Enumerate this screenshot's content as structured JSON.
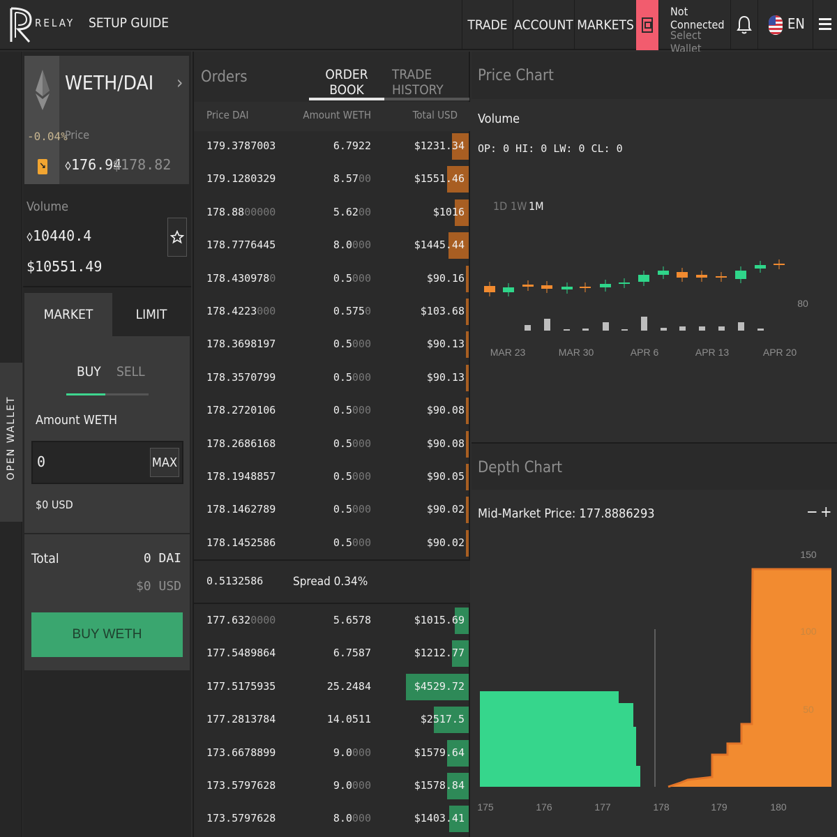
{
  "header": {
    "brand": "RELAY",
    "setup_guide": "SETUP GUIDE",
    "nav": [
      "TRADE",
      "ACCOUNT",
      "MARKETS"
    ],
    "wallet_status": "Not Connected",
    "wallet_action": "Select Wallet",
    "language": "EN"
  },
  "sidebar": {
    "open_wallet": "OPEN WALLET"
  },
  "pair": {
    "name": "WETH/DAI",
    "change_pct": "-0.04%",
    "price_label": "Price",
    "price": "⬨176.94",
    "price_usd": "$178.82",
    "volume_label": "Volume",
    "volume_eth": "⬨10440.4",
    "volume_usd": "$10551.49"
  },
  "trade_form": {
    "tab_market": "MARKET",
    "tab_limit": "LIMIT",
    "side_buy": "BUY",
    "side_sell": "SELL",
    "amount_label": "Amount WETH",
    "amount_value": "0",
    "max_label": "MAX",
    "usd_hint": "$0 USD",
    "total_label": "Total",
    "total_dai": "0 DAI",
    "total_usd": "$0 USD",
    "buy_button": "BUY WETH"
  },
  "orders": {
    "title": "Orders",
    "tab_order_book": "ORDER BOOK",
    "tab_trade_history": "TRADE HISTORY",
    "col_price": "Price DAI",
    "col_amount": "Amount WETH",
    "col_total": "Total USD",
    "asks": [
      {
        "price": "179.3787003",
        "price_dim": "",
        "amount": "6.7922",
        "amount_dim": "",
        "total": "$1231.34",
        "depth": 0.27
      },
      {
        "price": "179.1280329",
        "price_dim": "",
        "amount": "8.57",
        "amount_dim": "00",
        "total": "$1551.46",
        "depth": 0.34
      },
      {
        "price": "178.88",
        "price_dim": "00000",
        "amount": "5.62",
        "amount_dim": "00",
        "total": "$1016",
        "depth": 0.22
      },
      {
        "price": "178.7776445",
        "price_dim": "",
        "amount": "8.0",
        "amount_dim": "000",
        "total": "$1445.44",
        "depth": 0.32
      },
      {
        "price": "178.430978",
        "price_dim": "0",
        "amount": "0.5",
        "amount_dim": "000",
        "total": "$90.16",
        "depth": 0.02
      },
      {
        "price": "178.4223",
        "price_dim": "000",
        "amount": "0.575",
        "amount_dim": "0",
        "total": "$103.68",
        "depth": 0.02
      },
      {
        "price": "178.3698197",
        "price_dim": "",
        "amount": "0.5",
        "amount_dim": "000",
        "total": "$90.13",
        "depth": 0.02
      },
      {
        "price": "178.3570799",
        "price_dim": "",
        "amount": "0.5",
        "amount_dim": "000",
        "total": "$90.13",
        "depth": 0.02
      },
      {
        "price": "178.2720106",
        "price_dim": "",
        "amount": "0.5",
        "amount_dim": "000",
        "total": "$90.08",
        "depth": 0.02
      },
      {
        "price": "178.2686168",
        "price_dim": "",
        "amount": "0.5",
        "amount_dim": "000",
        "total": "$90.08",
        "depth": 0.02
      },
      {
        "price": "178.1948857",
        "price_dim": "",
        "amount": "0.5",
        "amount_dim": "000",
        "total": "$90.05",
        "depth": 0.02
      },
      {
        "price": "178.1462789",
        "price_dim": "",
        "amount": "0.5",
        "amount_dim": "000",
        "total": "$90.02",
        "depth": 0.02
      },
      {
        "price": "178.1452586",
        "price_dim": "",
        "amount": "0.5",
        "amount_dim": "000",
        "total": "$90.02",
        "depth": 0.02
      }
    ],
    "spread_value": "0.5132586",
    "spread_label": "Spread 0.34%",
    "bids": [
      {
        "price": "177.632",
        "price_dim": "0000",
        "amount": "5.6578",
        "amount_dim": "",
        "total": "$1015.69",
        "depth": 0.22
      },
      {
        "price": "177.5489864",
        "price_dim": "",
        "amount": "6.7587",
        "amount_dim": "",
        "total": "$1212.77",
        "depth": 0.27
      },
      {
        "price": "177.5175935",
        "price_dim": "",
        "amount": "25.2484",
        "amount_dim": "",
        "total": "$4529.72",
        "depth": 1.0
      },
      {
        "price": "177.2813784",
        "price_dim": "",
        "amount": "14.0511",
        "amount_dim": "",
        "total": "$2517.5",
        "depth": 0.56
      },
      {
        "price": "173.6678899",
        "price_dim": "",
        "amount": "9.0",
        "amount_dim": "000",
        "total": "$1579.64",
        "depth": 0.35
      },
      {
        "price": "173.5797628",
        "price_dim": "",
        "amount": "9.0",
        "amount_dim": "000",
        "total": "$1578.84",
        "depth": 0.35
      },
      {
        "price": "173.5797628",
        "price_dim": "",
        "amount": "8.0",
        "amount_dim": "000",
        "total": "$1403.41",
        "depth": 0.31
      }
    ]
  },
  "price_chart": {
    "title": "Price Chart",
    "volume_title": "Volume",
    "ohlc": "OP: 0 HI: 0 LW: 0 CL: 0",
    "ranges": [
      "1D",
      "1W",
      "1M"
    ],
    "active_range": "1M",
    "x_labels": [
      "MAR 23",
      "MAR 30",
      "APR 6",
      "APR 13",
      "APR 20"
    ],
    "y_label": "80",
    "colors": {
      "up": "#2fd68a",
      "down": "#f28b30"
    }
  },
  "depth_chart": {
    "title": "Depth Chart",
    "mid_market": "Mid-Market Price: 177.8886293",
    "zoom_out": "−",
    "zoom_in": "+",
    "x_labels": [
      "175",
      "176",
      "177",
      "178",
      "179",
      "180"
    ],
    "y_labels": [
      "150",
      "100",
      "50"
    ],
    "colors": {
      "bids": "#36d68c",
      "asks": "#f28b30"
    }
  }
}
